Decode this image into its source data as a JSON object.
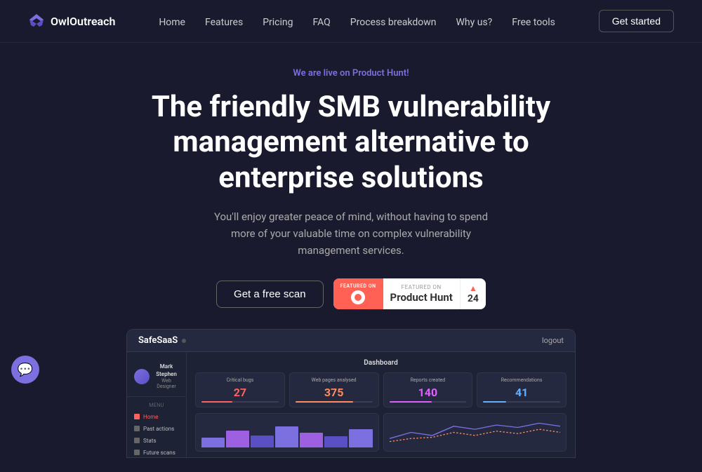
{
  "navbar": {
    "logo_text": "OwlOutreach",
    "nav_items": [
      {
        "label": "Home",
        "href": "#"
      },
      {
        "label": "Features",
        "href": "#"
      },
      {
        "label": "Pricing",
        "href": "#"
      },
      {
        "label": "FAQ",
        "href": "#"
      },
      {
        "label": "Process breakdown",
        "href": "#"
      },
      {
        "label": "Why us?",
        "href": "#"
      },
      {
        "label": "Free tools",
        "href": "#"
      }
    ],
    "cta_label": "Get started"
  },
  "hero": {
    "live_badge": "We are live on Product Hunt!",
    "title": "The friendly SMB vulnerability management alternative to enterprise solutions",
    "subtitle": "You'll enjoy greater peace of mind, without having to spend more of your valuable time on complex vulnerability management services.",
    "cta_primary": "Get a free scan",
    "ph_featured_on": "FEATURED ON",
    "ph_name": "Product Hunt",
    "ph_count": "24"
  },
  "dashboard": {
    "app_name": "SafeSaaS",
    "logout_label": "logout",
    "user": {
      "name": "Mark Stephen",
      "role": "Web Designer"
    },
    "menu_label": "MENU",
    "menu_items": [
      {
        "label": "Home",
        "active": true
      },
      {
        "label": "Past actions",
        "active": false
      },
      {
        "label": "Stats",
        "active": false
      },
      {
        "label": "Future scans",
        "active": false
      }
    ],
    "main_title": "Dashboard",
    "cards": [
      {
        "label": "Critical bugs",
        "value": "27"
      },
      {
        "label": "Web pages analysed",
        "value": "375"
      },
      {
        "label": "Reports created",
        "value": "140"
      },
      {
        "label": "Recommendations",
        "value": "41"
      }
    ]
  }
}
